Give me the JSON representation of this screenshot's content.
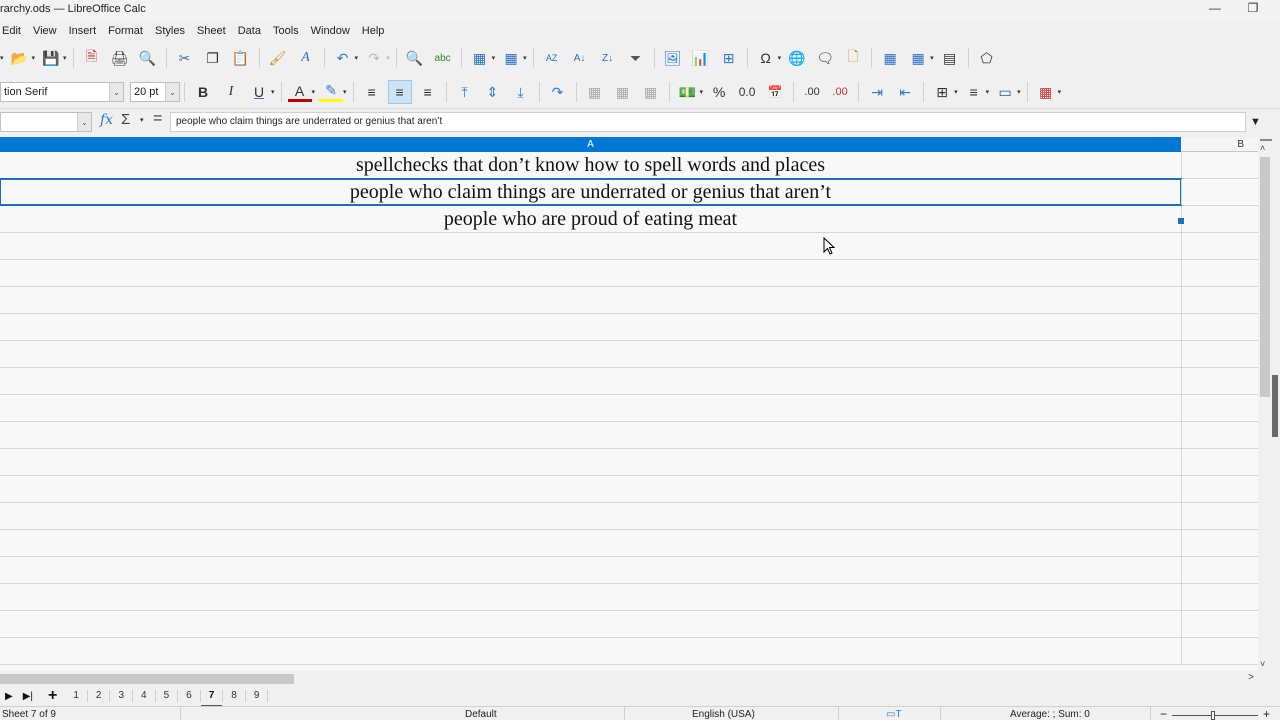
{
  "window": {
    "title": "rarchy.ods — LibreOffice Calc",
    "minimize_icon": "minimize-icon",
    "restore_icon": "restore-icon"
  },
  "menu": [
    "Edit",
    "View",
    "Insert",
    "Format",
    "Styles",
    "Sheet",
    "Data",
    "Tools",
    "Window",
    "Help"
  ],
  "toolbar1": {
    "icons": [
      "open-icon",
      "save-icon",
      "export-pdf-icon",
      "print-icon",
      "print-preview-icon",
      "cut-icon",
      "copy-icon",
      "paste-icon",
      "clone-formatting-icon",
      "clear-formatting-icon",
      "undo-icon",
      "redo-icon",
      "find-replace-icon",
      "spellcheck-icon",
      "row-icon",
      "column-icon",
      "sort-icon",
      "sort-ascending-icon",
      "sort-descending-icon",
      "autofilter-icon",
      "image-icon",
      "chart-icon",
      "pivot-table-icon",
      "special-character-icon",
      "hyperlink-icon",
      "comment-icon",
      "header-footer-icon",
      "define-print-area-icon",
      "freeze-rows-icon",
      "split-window-icon",
      "draw-functions-icon"
    ]
  },
  "toolbar2": {
    "font_name": "tion Serif",
    "font_size": "20 pt",
    "bold_label": "B",
    "italic_label": "I",
    "underline_label": "U",
    "font_color": "#c00000",
    "highlight_color": "#ffff00",
    "percent_label": "%",
    "number_label": "0.0",
    "add_decimal_label": ".00",
    "del_decimal_label": ".00"
  },
  "formula_bar": {
    "name_box_value": "",
    "fx_label": "fx",
    "sigma_label": "Σ",
    "equals_label": "=",
    "content": "people who claim things are underrated or genius that aren’t"
  },
  "grid": {
    "columns": [
      "A",
      "B"
    ],
    "selected_column": "A",
    "rows": [
      {
        "A": "spellchecks that don’t know how to spell words and places",
        "selected": false
      },
      {
        "A": "people who claim things are underrated or genius that aren’t",
        "selected": true
      },
      {
        "A": "people who are proud of eating meat",
        "selected": false
      }
    ],
    "selection_color": "#0078d4"
  },
  "sheet_tabs": {
    "tabs": [
      "1",
      "2",
      "3",
      "4",
      "5",
      "6",
      "7",
      "8",
      "9"
    ],
    "active": "7",
    "add_label": "+"
  },
  "status_bar": {
    "sheet_info": "Sheet 7 of 9",
    "page_style": "Default",
    "language": "English (USA)",
    "summary": "Average: ; Sum: 0",
    "zoom_minus": "−",
    "zoom_plus": "+"
  }
}
